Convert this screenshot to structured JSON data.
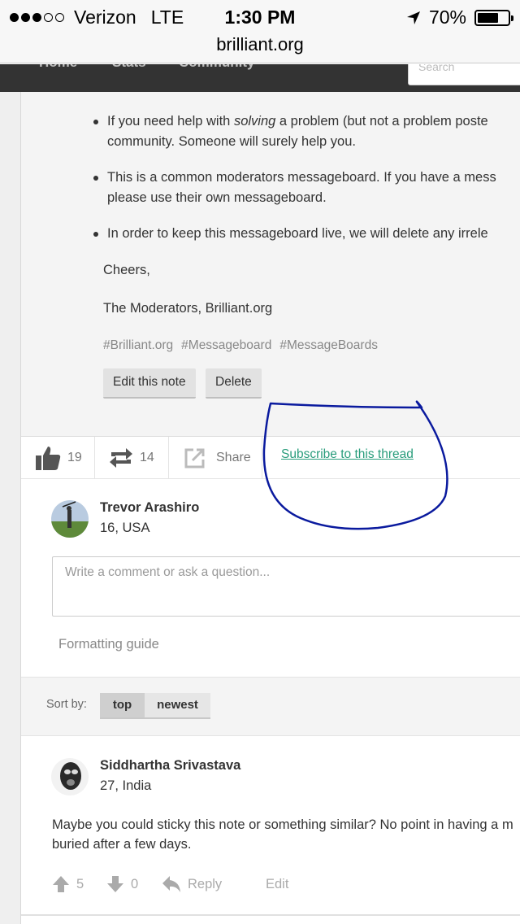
{
  "status_bar": {
    "carrier": "Verizon",
    "network": "LTE",
    "time": "1:30 PM",
    "battery_text": "70%",
    "battery_level": 0.7,
    "signal_bars_filled": 3,
    "signal_bars_total": 5
  },
  "browser": {
    "url": "brilliant.org"
  },
  "site_nav": {
    "items": [
      "Home",
      "Stats",
      "Community"
    ],
    "search_placeholder": "Search"
  },
  "note": {
    "bullets": [
      {
        "line1_pre": "If you need help with ",
        "line1_em": "solving",
        "line1_post": " a problem (but not a problem poste",
        "line2": "community. Someone will surely help you."
      },
      {
        "line1": "This is a common moderators messageboard. If you have a mess",
        "line2": "please use their own messageboard."
      },
      {
        "line1": "In order to keep this messageboard live, we will delete any irrele"
      }
    ],
    "closing": "Cheers,",
    "signature": "The Moderators, Brilliant.org",
    "tags": [
      "#Brilliant.org",
      "#Messageboard",
      "#MessageBoards"
    ],
    "edit_label": "Edit this note",
    "delete_label": "Delete"
  },
  "actions": {
    "likes": "19",
    "reshares": "14",
    "share_label": "Share",
    "subscribe_label": "Subscribe to this thread"
  },
  "composer": {
    "user_name": "Trevor Arashiro",
    "user_meta": "16, USA",
    "placeholder": "Write a comment or ask a question...",
    "formatting_guide": "Formatting guide"
  },
  "sort": {
    "label": "Sort by:",
    "options": [
      "top",
      "newest"
    ],
    "selected": "top"
  },
  "comments": [
    {
      "author": "Siddhartha Srivastava",
      "meta": "27, India",
      "text_line1": "Maybe you could sticky this note or something similar? No point in having a m",
      "text_line2": "buried after a few days.",
      "upvotes": "5",
      "downvotes": "0",
      "reply_label": "Reply",
      "edit_label": "Edit"
    }
  ],
  "colors": {
    "link": "#2a9d7c",
    "nav_bg": "#333333",
    "annotation": "#0a1a9e"
  }
}
